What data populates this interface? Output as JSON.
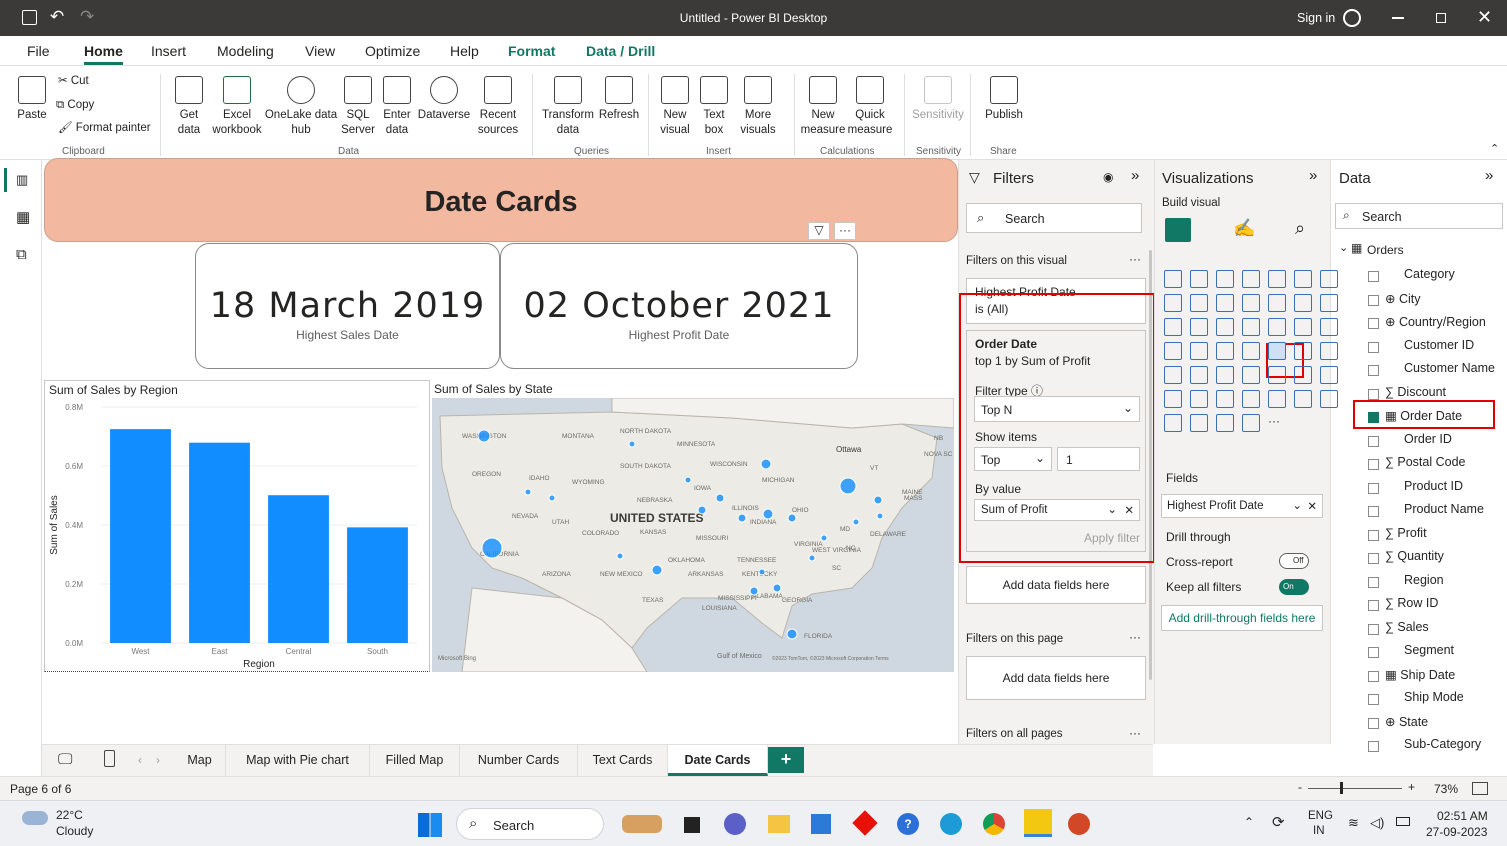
{
  "window": {
    "title": "Untitled - Power BI Desktop",
    "sign_in": "Sign in"
  },
  "menu": [
    "File",
    "Home",
    "Insert",
    "Modeling",
    "View",
    "Optimize",
    "Help",
    "Format",
    "Data / Drill"
  ],
  "ribbon": {
    "clipboard": {
      "paste": "Paste",
      "cut": "Cut",
      "copy": "Copy",
      "format_painter": "Format painter",
      "group": "Clipboard"
    },
    "data": {
      "get_data": "Get data",
      "excel": "Excel workbook",
      "onelake": "OneLake data hub",
      "sql": "SQL Server",
      "enter": "Enter data",
      "dataverse": "Dataverse",
      "recent": "Recent sources",
      "group": "Data"
    },
    "queries": {
      "transform": "Transform data",
      "refresh": "Refresh",
      "group": "Queries"
    },
    "insert": {
      "new_visual": "New visual",
      "text_box": "Text box",
      "more_visuals": "More visuals",
      "group": "Insert"
    },
    "calculations": {
      "new_measure": "New measure",
      "quick_measure": "Quick measure",
      "group": "Calculations"
    },
    "sensitivity": {
      "label": "Sensitivity",
      "group": "Sensitivity"
    },
    "share": {
      "publish": "Publish",
      "group": "Share"
    }
  },
  "report": {
    "title": "Date Cards",
    "card1": {
      "value": "18 March 2019",
      "label": "Highest Sales Date"
    },
    "card2": {
      "value": "02 October 2021",
      "label": "Highest Profit Date"
    },
    "map_title": "Sum of Sales by State",
    "map_labels": {
      "us": "UNITED STATES",
      "gulf": "Gulf of Mexico",
      "ottawa": "Ottawa",
      "bing": "Microsoft Bing",
      "copyright": "©2023 TomTom, ©2023 Microsoft Corporation Terms"
    },
    "map_states": [
      "WASHINGTON",
      "MONTANA",
      "NORTH DAKOTA",
      "MINNESOTA",
      "OREGON",
      "IDAHO",
      "SOUTH DAKOTA",
      "WISCONSIN",
      "MICHIGAN",
      "WYOMING",
      "IOWA",
      "NEBRASKA",
      "NEVADA",
      "UTAH",
      "COLORADO",
      "KANSAS",
      "MISSOURI",
      "ILLINOIS",
      "INDIANA",
      "OHIO",
      "CALIFORNIA",
      "OKLAHOMA",
      "TENNESSEE",
      "KENTUCKY",
      "VIRGINIA",
      "ARIZONA",
      "NEW MEXICO",
      "ARKANSAS",
      "TEXAS",
      "LOUISIANA",
      "MISSISSIPPI",
      "ALABAMA",
      "GEORGIA",
      "FLORIDA",
      "SC",
      "NC",
      "WEST VIRGINIA",
      "MD",
      "DELAWARE",
      "MAINE",
      "MASS",
      "NB",
      "NOVA SC",
      "VT"
    ]
  },
  "chart_data": {
    "type": "bar",
    "title": "Sum of Sales by Region",
    "xlabel": "Region",
    "ylabel": "Sum of Sales",
    "categories": [
      "West",
      "East",
      "Central",
      "South"
    ],
    "values": [
      725000,
      679000,
      501000,
      392000
    ],
    "ylim": [
      0,
      800000
    ],
    "yticks": [
      "0.0M",
      "0.2M",
      "0.4M",
      "0.6M",
      "0.8M"
    ],
    "color": "#118dff"
  },
  "filters": {
    "title": "Filters",
    "search": "Search",
    "on_visual": "Filters on this visual",
    "f1_name": "Highest Profit Date",
    "f1_value": "is (All)",
    "f2_name": "Order Date",
    "f2_value": "top 1 by Sum of Profit",
    "filter_type_label": "Filter type",
    "filter_type": "Top N",
    "show_items_label": "Show items",
    "show_dir": "Top",
    "show_count": "1",
    "by_value_label": "By value",
    "by_value": "Sum of Profit",
    "apply": "Apply filter",
    "add_fields": "Add data fields here",
    "on_page": "Filters on this page",
    "add_fields2": "Add data fields here",
    "on_all": "Filters on all pages"
  },
  "visualizations": {
    "title": "Visualizations",
    "build": "Build visual",
    "fields_label": "Fields",
    "field_value": "Highest Profit Date",
    "drill": "Drill through",
    "cross_report": "Cross-report",
    "cross_state": "Off",
    "keep_filters": "Keep all filters",
    "keep_state": "On",
    "add_drill": "Add drill-through fields here"
  },
  "data_pane": {
    "title": "Data",
    "search": "Search",
    "table": "Orders",
    "fields": [
      "Category",
      "City",
      "Country/Region",
      "Customer ID",
      "Customer Name",
      "Discount",
      "Order Date",
      "Order ID",
      "Postal Code",
      "Product ID",
      "Product Name",
      "Profit",
      "Quantity",
      "Region",
      "Row ID",
      "Sales",
      "Segment",
      "Ship Date",
      "Ship Mode",
      "State",
      "Sub-Category"
    ]
  },
  "page_tabs": [
    "Map",
    "Map with Pie chart",
    "Filled Map",
    "Number Cards",
    "Text Cards",
    "Date Cards"
  ],
  "status": {
    "page": "Page 6 of 6",
    "zoom": "73%"
  },
  "taskbar": {
    "temp": "22°C",
    "weather": "Cloudy",
    "search": "Search",
    "lang1": "ENG",
    "lang2": "IN",
    "time": "02:51 AM",
    "date": "27-09-2023"
  }
}
